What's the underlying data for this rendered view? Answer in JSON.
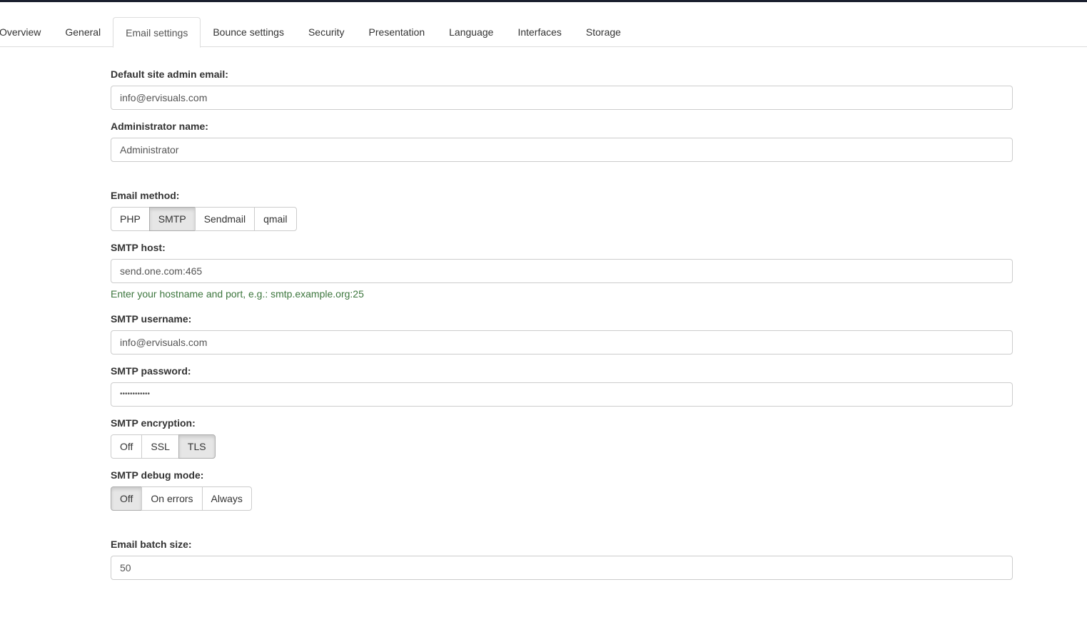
{
  "tabs": [
    "Overview",
    "General",
    "Email settings",
    "Bounce settings",
    "Security",
    "Presentation",
    "Language",
    "Interfaces",
    "Storage"
  ],
  "active_tab": "Email settings",
  "fields": {
    "admin_email": {
      "label": "Default site admin email:",
      "value": "info@ervisuals.com"
    },
    "admin_name": {
      "label": "Administrator name:",
      "value": "Administrator"
    },
    "email_method": {
      "label": "Email method:",
      "options": [
        "PHP",
        "SMTP",
        "Sendmail",
        "qmail"
      ],
      "selected": "SMTP"
    },
    "smtp_host": {
      "label": "SMTP host:",
      "value": "send.one.com:465",
      "help": "Enter your hostname and port, e.g.: smtp.example.org:25"
    },
    "smtp_username": {
      "label": "SMTP username:",
      "value": "info@ervisuals.com"
    },
    "smtp_password": {
      "label": "SMTP password:",
      "value": "••••••••••••"
    },
    "smtp_encryption": {
      "label": "SMTP encryption:",
      "options": [
        "Off",
        "SSL",
        "TLS"
      ],
      "selected": "TLS"
    },
    "smtp_debug": {
      "label": "SMTP debug mode:",
      "options": [
        "Off",
        "On errors",
        "Always"
      ],
      "selected": "Off"
    },
    "batch_size": {
      "label": "Email batch size:",
      "value": "50"
    }
  }
}
